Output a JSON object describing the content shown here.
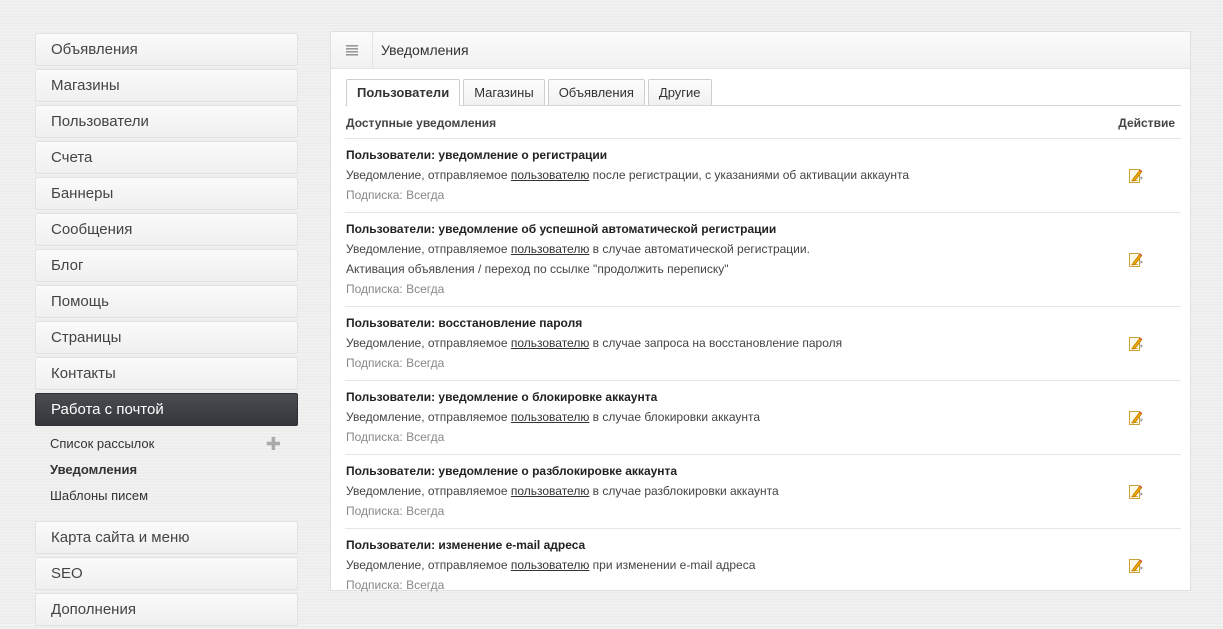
{
  "sidebar": {
    "items_top": [
      {
        "label": "Объявления"
      },
      {
        "label": "Магазины"
      },
      {
        "label": "Пользователи"
      },
      {
        "label": "Счета"
      },
      {
        "label": "Баннеры"
      },
      {
        "label": "Сообщения"
      },
      {
        "label": "Блог"
      },
      {
        "label": "Помощь"
      },
      {
        "label": "Страницы"
      },
      {
        "label": "Контакты"
      }
    ],
    "active": {
      "label": "Работа с почтой"
    },
    "subitems": [
      {
        "label": "Список рассылок"
      },
      {
        "label": "Уведомления"
      },
      {
        "label": "Шаблоны писем"
      }
    ],
    "items_bottom": [
      {
        "label": "Карта сайта и меню"
      },
      {
        "label": "SEO"
      },
      {
        "label": "Дополнения"
      }
    ]
  },
  "panel": {
    "title": "Уведомления",
    "tabs": [
      {
        "label": "Пользователи"
      },
      {
        "label": "Магазины"
      },
      {
        "label": "Объявления"
      },
      {
        "label": "Другие"
      }
    ],
    "columns": {
      "available": "Доступные уведомления",
      "action": "Действие"
    },
    "rows": [
      {
        "title": "Пользователи: уведомление о регистрации",
        "desc_pre": "Уведомление, отправляемое ",
        "desc_link": "пользователю",
        "desc_post": " после регистрации, с указаниями об активации аккаунта",
        "desc2": "",
        "sub": "Подписка: Всегда"
      },
      {
        "title": "Пользователи: уведомление об успешной автоматической регистрации",
        "desc_pre": "Уведомление, отправляемое ",
        "desc_link": "пользователю",
        "desc_post": " в случае автоматической регистрации.",
        "desc2": "Активация объявления / переход по ссылке \"продолжить переписку\"",
        "sub": "Подписка: Всегда"
      },
      {
        "title": "Пользователи: восстановление пароля",
        "desc_pre": "Уведомление, отправляемое ",
        "desc_link": "пользователю",
        "desc_post": " в случае запроса на восстановление пароля",
        "desc2": "",
        "sub": "Подписка: Всегда"
      },
      {
        "title": "Пользователи: уведомление о блокировке аккаунта",
        "desc_pre": "Уведомление, отправляемое ",
        "desc_link": "пользователю",
        "desc_post": " в случае блокировки аккаунта",
        "desc2": "",
        "sub": "Подписка: Всегда"
      },
      {
        "title": "Пользователи: уведомление о разблокировке аккаунта",
        "desc_pre": "Уведомление, отправляемое ",
        "desc_link": "пользователю",
        "desc_post": " в случае разблокировки аккаунта",
        "desc2": "",
        "sub": "Подписка: Всегда"
      },
      {
        "title": "Пользователи: изменение e-mail адреса",
        "desc_pre": "Уведомление, отправляемое ",
        "desc_link": "пользователю",
        "desc_post": " при изменении e-mail адреса",
        "desc2": "",
        "sub": "Подписка: Всегда"
      }
    ]
  },
  "icons": {
    "edit": "edit-pencil-icon",
    "menu": "list-menu-icon",
    "add": "plus-icon"
  },
  "colors": {
    "active_nav": "#3d3f44",
    "edit_icon": "#f2a900"
  }
}
